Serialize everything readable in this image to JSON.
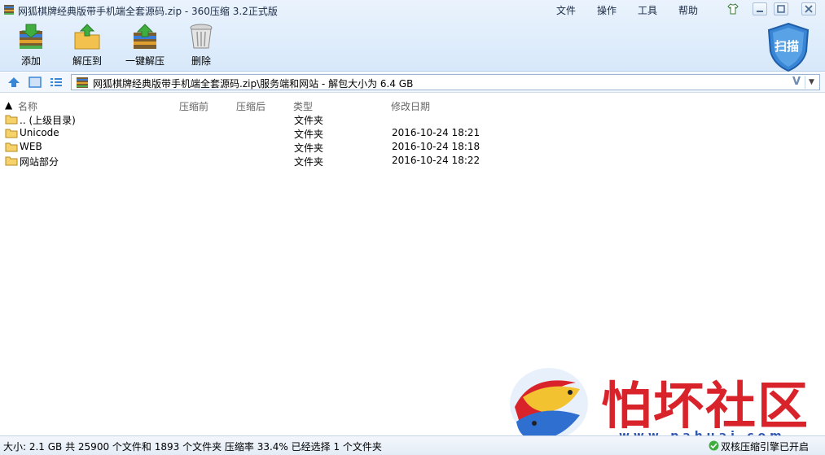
{
  "window": {
    "title": "网狐棋牌经典版带手机端全套源码.zip - 360压缩 3.2正式版"
  },
  "menu": [
    "文件",
    "操作",
    "工具",
    "帮助"
  ],
  "toolbar": {
    "add": "添加",
    "extract_to": "解压到",
    "one_click_extract": "一键解压",
    "delete": "删除",
    "scan": "扫描"
  },
  "address": {
    "path": "网狐棋牌经典版带手机端全套源码.zip\\服务端和网站 - 解包大小为 6.4 GB",
    "v_label": "V"
  },
  "columns": {
    "name": "名称",
    "packed": "压缩前",
    "compressed": "压缩后",
    "type": "类型",
    "modified": "修改日期"
  },
  "rows": [
    {
      "name": ".. (上级目录)",
      "type": "文件夹",
      "modified": ""
    },
    {
      "name": "Unicode",
      "type": "文件夹",
      "modified": "2016-10-24 18:21"
    },
    {
      "name": "WEB",
      "type": "文件夹",
      "modified": "2016-10-24 18:18"
    },
    {
      "name": "网站部分",
      "type": "文件夹",
      "modified": "2016-10-24 18:22"
    }
  ],
  "status": {
    "summary": "大小: 2.1 GB 共 25900 个文件和 1893 个文件夹 压缩率 33.4% 已经选择 1 个文件夹",
    "right": "双核压缩引擎已开启"
  },
  "watermark": {
    "text": "怕坏社区",
    "url": "www.pahuai.com"
  },
  "colors": {
    "accent": "#3a86d6",
    "watermark_red": "#d9232b"
  }
}
